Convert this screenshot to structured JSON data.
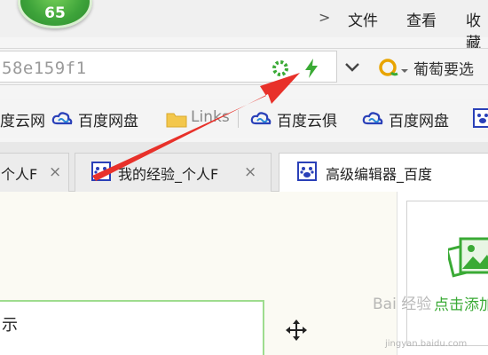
{
  "score": "65",
  "menu": {
    "chevron": ">",
    "file": "文件",
    "view": "查看",
    "collect": "收藏"
  },
  "address": {
    "url": "58e159f1",
    "search_text": "葡萄要选"
  },
  "bookmarks": [
    {
      "label": "度云网",
      "icon": "none"
    },
    {
      "label": "百度网盘",
      "icon": "baidu-cloud-icon"
    },
    {
      "label": "Links",
      "icon": "folder-icon"
    },
    {
      "label": "百度云俱",
      "icon": "baidu-cloud-icon"
    },
    {
      "label": "百度网盘",
      "icon": "baidu-cloud-icon"
    }
  ],
  "tabs": [
    {
      "label": "个人F",
      "close": "×",
      "active": false
    },
    {
      "label": "我的经验_个人F",
      "close": "×",
      "active": false
    },
    {
      "label": "高级编辑器_百度",
      "close": "",
      "active": true
    }
  ],
  "editor": {
    "text": "示"
  },
  "side_panel": {
    "add_label": "点击添加"
  },
  "watermark": {
    "text": "Bai 经验",
    "sub": "jingyan.baidu.com"
  },
  "colors": {
    "accent_green": "#3aaa35",
    "arrow_red": "#e8312a",
    "baidu_blue": "#2a40b8"
  }
}
